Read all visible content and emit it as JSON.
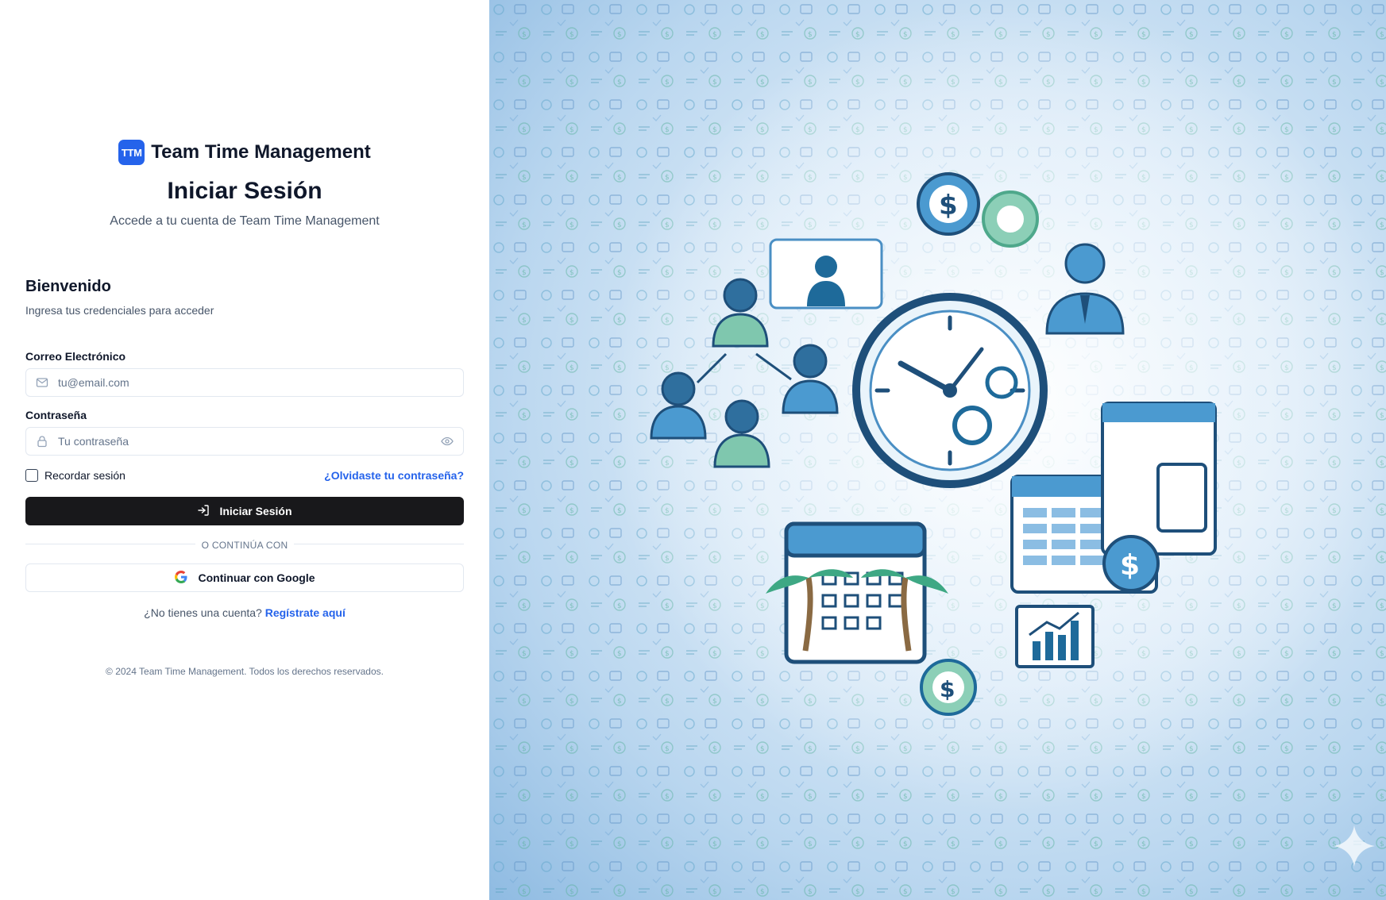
{
  "brand": {
    "logo_text": "TTM",
    "name": "Team Time Management",
    "accent_color": "#2563eb"
  },
  "header": {
    "title": "Iniciar Sesión",
    "subtitle": "Accede a tu cuenta de Team Time Management"
  },
  "card": {
    "title": "Bienvenido",
    "description": "Ingresa tus credenciales para acceder"
  },
  "form": {
    "email": {
      "label": "Correo Electrónico",
      "placeholder": "tu@email.com",
      "value": "",
      "icon": "mail-icon"
    },
    "password": {
      "label": "Contraseña",
      "placeholder": "Tu contraseña",
      "value": "",
      "icon": "lock-icon",
      "toggle_icon": "eye-icon"
    },
    "remember": {
      "label": "Recordar sesión",
      "checked": false
    },
    "forgot_link": "¿Olvidaste tu contraseña?",
    "submit": {
      "label": "Iniciar Sesión",
      "icon": "login-icon",
      "color": "#18181b"
    }
  },
  "divider_text": "O CONTINÚA CON",
  "google": {
    "label": "Continuar con Google",
    "icon": "google-icon"
  },
  "signup": {
    "prompt": "¿No tienes una cuenta?",
    "link": "Regístrate aquí"
  },
  "footer": "© 2024 Team Time Management. Todos los derechos reservados.",
  "illustration": {
    "description_icon": "team-time-management-illustration",
    "background_color": "#b9d6ef"
  }
}
